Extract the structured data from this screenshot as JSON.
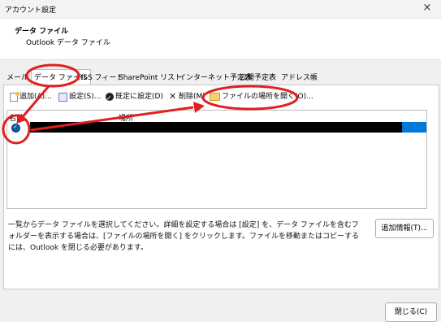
{
  "window": {
    "title": "アカウント設定",
    "close_glyph": "×"
  },
  "header": {
    "title": "データ ファイル",
    "subtitle": "Outlook データ ファイル"
  },
  "tabs": [
    {
      "label": "メール",
      "active": false
    },
    {
      "label": "データ ファイル",
      "active": true
    },
    {
      "label": "RSS フィード",
      "active": false
    },
    {
      "label": "SharePoint リスト",
      "active": false
    },
    {
      "label": "インターネット予定表",
      "active": false
    },
    {
      "label": "公開予定表",
      "active": false
    },
    {
      "label": "アドレス帳",
      "active": false
    }
  ],
  "toolbar": {
    "add": "追加(A)...",
    "settings": "設定(S)...",
    "set_default": "既定に設定(D)",
    "remove": "削除(M)",
    "open_location": "ファイルの場所を開く(O)..."
  },
  "list": {
    "columns": {
      "name": "名前",
      "location": "場所"
    },
    "rows": [
      {
        "checked": true,
        "redacted": true
      }
    ]
  },
  "description": "一覧からデータ ファイルを選択してください。詳細を設定する場合は [設定] を、データ ファイルを含むフォルダーを表示する場合は、[ファイルの場所を開く] をクリックします。ファイルを移動またはコピーするには、Outlook を閉じる必要があります。",
  "buttons": {
    "more_info": "追加情報(T)...",
    "close": "閉じる(C)"
  },
  "annotation_color": "#e02020"
}
